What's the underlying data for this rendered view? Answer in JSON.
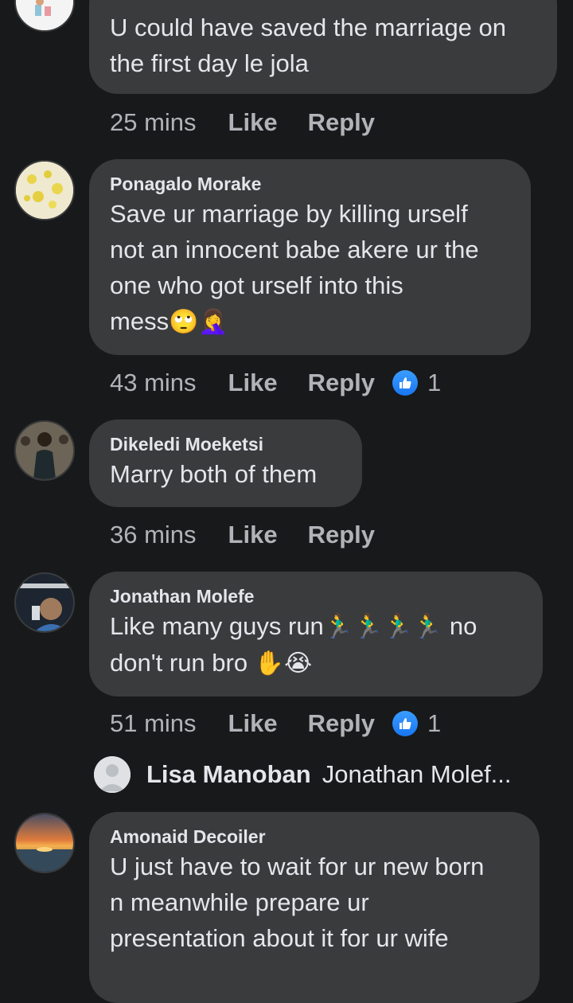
{
  "comments": [
    {
      "author": "",
      "lines": [
        "U could have saved the marriage on",
        "the first day le jola"
      ],
      "time": "25 mins",
      "like_label": "Like",
      "reply_label": "Reply",
      "reactions": null
    },
    {
      "author": "Ponagalo Morake",
      "lines": [
        "Save ur marriage by killing urself",
        "not an innocent babe akere ur the",
        "one who got urself into this",
        "mess"
      ],
      "emoji_tail": "🙄🤦‍♀️",
      "time": "43 mins",
      "like_label": "Like",
      "reply_label": "Reply",
      "reactions": "1"
    },
    {
      "author": "Dikeledi Moeketsi",
      "lines": [
        "Marry both of them"
      ],
      "time": "36 mins",
      "like_label": "Like",
      "reply_label": "Reply",
      "reactions": null
    },
    {
      "author": "Jonathan Molefe",
      "line1_text": "Like many guys run",
      "line1_emoji": "🏃‍♂️🏃‍♂️🏃‍♂️🏃‍♂️",
      "line1_end": "no",
      "line2_text": "don't run bro",
      "line2_emoji": "✋😭",
      "time": "51 mins",
      "like_label": "Like",
      "reply_label": "Reply",
      "reactions": "1"
    },
    {
      "author": "Amonaid Decoiler",
      "lines": [
        "U just have to wait for ur new born",
        "n meanwhile prepare ur",
        "presentation about it for ur wife"
      ]
    }
  ],
  "reply_preview": {
    "author": "Lisa Manoban",
    "text": "Jonathan Molef..."
  },
  "colors": {
    "background": "#18191a",
    "bubble": "#3a3b3c",
    "meta_text": "#b0b3b8",
    "like_blue": "#1877f2"
  }
}
